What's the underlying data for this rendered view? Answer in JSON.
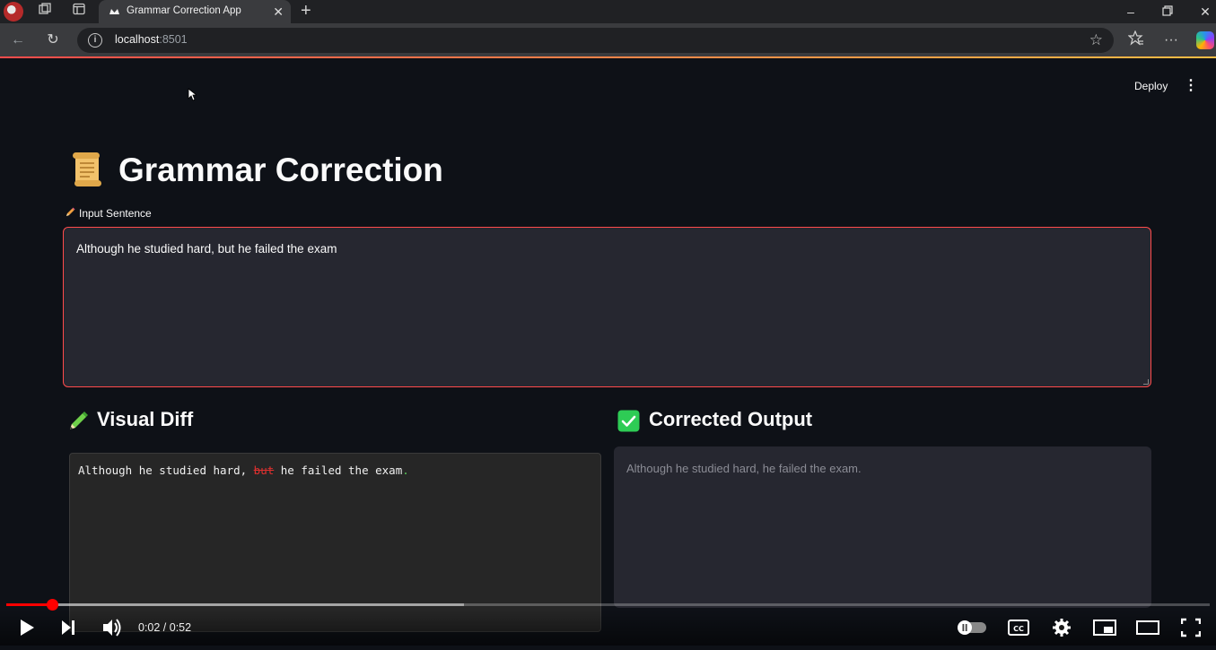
{
  "browser": {
    "tab_title": "Grammar Correction App",
    "url_host": "localhost",
    "url_port": ":8501"
  },
  "app": {
    "deploy_label": "Deploy",
    "title": "Grammar Correction",
    "input_label": "Input Sentence",
    "input_value": "Although he studied hard, but he failed the exam",
    "visual_diff_title": "Visual Diff",
    "diff": {
      "before": "Although he studied hard, ",
      "deleted": "but",
      "after": " he failed the exam",
      "added": "."
    },
    "corrected_title": "Corrected Output",
    "corrected_value": "Although he studied hard, he failed the exam."
  },
  "player": {
    "time_display": "0:02 / 0:52",
    "played_fraction": 0.0385,
    "buffered_fraction": 0.38
  },
  "colors": {
    "accent": "#ff4b4b",
    "background": "#0e1117",
    "input_bg": "#262730",
    "diff_deleted": "#e0302f",
    "diff_added": "#5ac85a",
    "progress": "#ff0000"
  },
  "icons": {
    "title": "scroll-icon",
    "input_label": "pencil-icon",
    "visual_diff": "highlighter-pencil-icon",
    "corrected": "check-mark-button-icon"
  }
}
